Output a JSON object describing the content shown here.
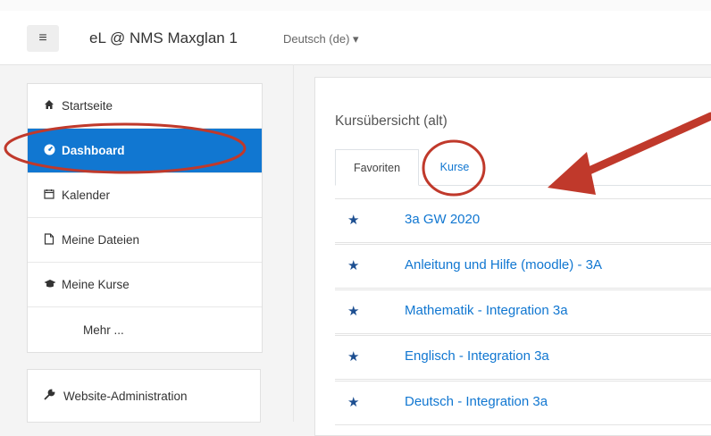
{
  "header": {
    "menu_icon": "hamburger-icon",
    "brand": "eL @ NMS Maxglan 1",
    "language": "Deutsch (de) ▾"
  },
  "sidebar": {
    "items": [
      {
        "label": "Startseite",
        "icon": "home-icon"
      },
      {
        "label": "Dashboard",
        "icon": "dashboard-icon"
      },
      {
        "label": "Kalender",
        "icon": "calendar-icon"
      },
      {
        "label": "Meine Dateien",
        "icon": "file-icon"
      },
      {
        "label": "Meine Kurse",
        "icon": "graduation-cap-icon"
      },
      {
        "label": "Mehr ..."
      }
    ],
    "admin": {
      "label": "Website-Administration",
      "icon": "wrench-icon"
    }
  },
  "main": {
    "title": "Kursübersicht (alt)",
    "tabs": [
      {
        "label": "Favoriten"
      },
      {
        "label": "Kurse"
      }
    ],
    "courses": [
      "3a GW 2020",
      "Anleitung und Hilfe (moodle) - 3A",
      "Mathematik - Integration 3a",
      "Englisch - Integration 3a",
      "Deutsch - Integration 3a"
    ]
  },
  "colors": {
    "accent": "#1177d1",
    "annotation": "#c0392b",
    "star": "#1d4f91"
  }
}
